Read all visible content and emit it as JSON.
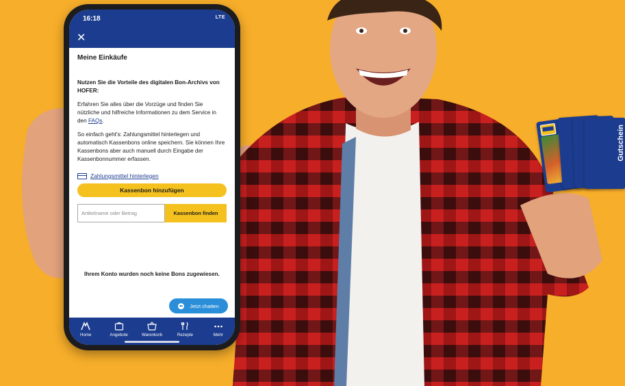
{
  "status": {
    "time": "16:18",
    "signal": "LTE"
  },
  "app": {
    "close_icon": "close-icon",
    "title": "Meine Einkäufe",
    "lead": "Nutzen Sie die Vorteile des digitalen Bon-Archivs von HOFER:",
    "para1_text": "Erfahren Sie alles über die Vorzüge und finden Sie nützliche und hilfreiche Informationen zu dem Service in den ",
    "para1_link": "FAQs",
    "para1_end": ".",
    "para2": "So einfach geht's: Zahlungsmittel hinterlegen und automatisch Kassenbons online speichern. Sie können Ihre Kassenbons aber auch manuell durch Eingabe der Kassenbonnummer erfassen.",
    "payment_link": "Zahlungsmittel hinterlegen",
    "add_button": "Kassenbon hinzufügen",
    "search_placeholder": "Artikelname oder Betrag",
    "find_button": "Kassenbon finden",
    "empty_state": "Ihrem Konto wurden noch keine Bons zugewiesen.",
    "chat_button": "Jetzt chatten",
    "tabs": [
      {
        "label": "Home",
        "icon": "home-icon"
      },
      {
        "label": "Angebote",
        "icon": "offers-icon"
      },
      {
        "label": "Warenkorb",
        "icon": "basket-icon"
      },
      {
        "label": "Rezepte",
        "icon": "recipes-icon"
      },
      {
        "label": "Mehr",
        "icon": "more-icon"
      }
    ]
  },
  "giftcards": {
    "label": "Gutschein",
    "brand": "HOFER"
  },
  "colors": {
    "background": "#f7ae2a",
    "brand_blue": "#1c3d8f",
    "accent_yellow": "#f4c11e",
    "chat_blue": "#2a8fd8"
  }
}
